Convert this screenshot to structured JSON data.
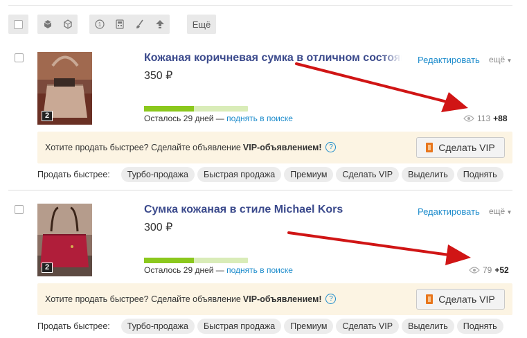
{
  "toolbar": {
    "more_label": "Ещё"
  },
  "items": [
    {
      "title": "Кожаная коричневая сумка в отличном состоянии",
      "price": "350 ₽",
      "photo_count": "2",
      "edit_label": "Редактировать",
      "more_label": "ещё",
      "days_left": "Осталось 29 дней —",
      "raise_link": "поднять в поиске",
      "progress": 0.48,
      "views": "113",
      "views_delta": "+88",
      "vip_prompt": "Хотите продать быстрее? Сделайте объявление",
      "vip_prompt_bold": "VIP-объявлением!",
      "vip_button": "Сделать VIP",
      "sell_label": "Продать быстрее:",
      "services": [
        "Турбо-продажа",
        "Быстрая продажа",
        "Премиум",
        "Сделать VIP",
        "Выделить",
        "Поднять"
      ]
    },
    {
      "title": "Сумка кожаная в стиле Michael Kors",
      "price": "300 ₽",
      "photo_count": "2",
      "edit_label": "Редактировать",
      "more_label": "ещё",
      "days_left": "Осталось 29 дней —",
      "raise_link": "поднять в поиске",
      "progress": 0.48,
      "views": "79",
      "views_delta": "+52",
      "vip_prompt": "Хотите продать быстрее? Сделайте объявление",
      "vip_prompt_bold": "VIP-объявлением!",
      "vip_button": "Сделать VIP",
      "sell_label": "Продать быстрее:",
      "services": [
        "Турбо-продажа",
        "Быстрая продажа",
        "Премиум",
        "Сделать VIP",
        "Выделить",
        "Поднять"
      ]
    }
  ],
  "colors": {
    "title": "#3b4a8c",
    "link": "#1d8ccc",
    "progress_fill": "#8bc81d",
    "vip_background": "#fcf4e3",
    "annotation_arrow": "#d01515"
  }
}
